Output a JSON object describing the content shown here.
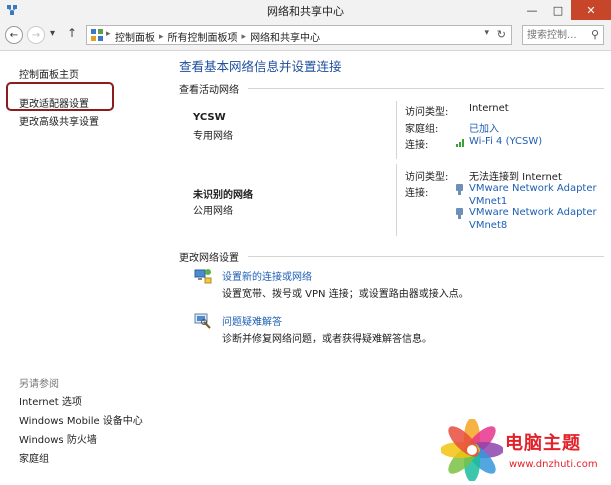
{
  "window": {
    "title": "网络和共享中心"
  },
  "address": {
    "crumbs": [
      "控制面板",
      "所有控制面板项",
      "网络和共享中心"
    ],
    "search_placeholder": "搜索控制..."
  },
  "sidebar": {
    "items": [
      "控制面板主页",
      "更改适配器设置",
      "更改高级共享设置"
    ],
    "see_also_label": "另请参阅",
    "see_also": [
      "Internet 选项",
      "Windows Mobile 设备中心",
      "Windows 防火墙",
      "家庭组"
    ]
  },
  "main": {
    "heading": "查看基本网络信息并设置连接",
    "active_networks_title": "查看活动网络",
    "networks": [
      {
        "name": "YCSW",
        "type": "专用网络",
        "access_label": "访问类型:",
        "access_value": "Internet",
        "homegroup_label": "家庭组:",
        "homegroup_value": "已加入",
        "conn_label": "连接:",
        "conn_value": "Wi-Fi 4 (YCSW)"
      },
      {
        "name": "未识别的网络",
        "type": "公用网络",
        "access_label": "访问类型:",
        "access_value": "无法连接到 Internet",
        "conn_label": "连接:",
        "conn1_line1": "VMware Network Adapter",
        "conn1_line2": "VMnet1",
        "conn2_line1": "VMware Network Adapter",
        "conn2_line2": "VMnet8"
      }
    ],
    "change_settings_title": "更改网络设置",
    "tasks": [
      {
        "link": "设置新的连接或网络",
        "desc": "设置宽带、拨号或 VPN 连接；或设置路由器或接入点。",
        "icon": "new-connection-icon"
      },
      {
        "link": "问题疑难解答",
        "desc": "诊断并修复网络问题，或者获得疑难解答信息。",
        "icon": "troubleshoot-icon"
      }
    ]
  },
  "watermark": {
    "text": "电脑主题",
    "url": "www.dnzhuti.com"
  },
  "colors": {
    "link": "#1e5fb4",
    "heading": "#1e4f9c",
    "highlight": "#8c1c1c"
  }
}
